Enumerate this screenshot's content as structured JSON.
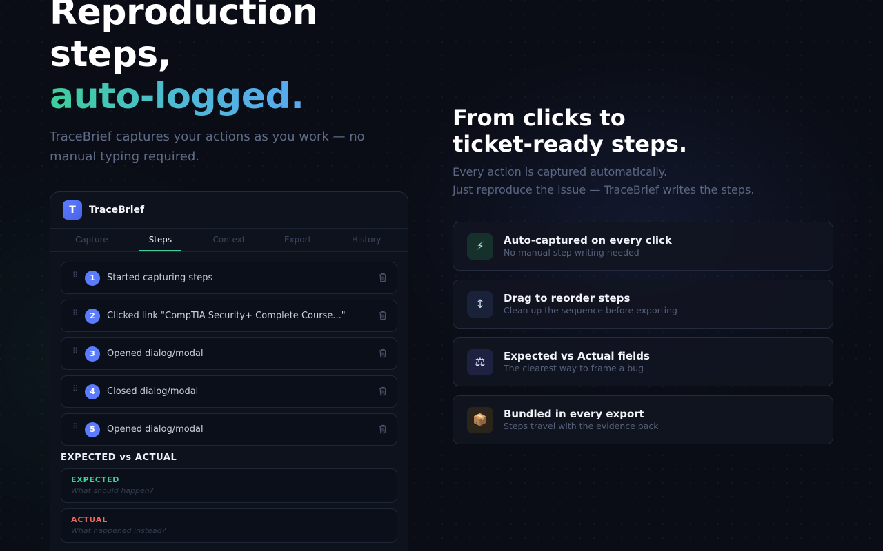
{
  "hero": {
    "title_line1": "Reproduction",
    "title_line2": "steps,",
    "title_highlight": "auto-logged.",
    "subtitle": "TraceBrief captures your actions as you work — no manual typing required."
  },
  "app": {
    "logo_letter": "T",
    "name": "TraceBrief",
    "tabs": [
      {
        "label": "Capture",
        "active": false
      },
      {
        "label": "Steps",
        "active": true
      },
      {
        "label": "Context",
        "active": false
      },
      {
        "label": "Export",
        "active": false
      },
      {
        "label": "History",
        "active": false
      }
    ],
    "steps": [
      {
        "num": "1",
        "text": "Started capturing steps"
      },
      {
        "num": "2",
        "text": "Clicked link \"CompTIA Security+ Complete Course...\""
      },
      {
        "num": "3",
        "text": "Opened dialog/modal"
      },
      {
        "num": "4",
        "text": "Closed dialog/modal"
      },
      {
        "num": "5",
        "text": "Opened dialog/modal"
      }
    ],
    "eva_title": "EXPECTED vs ACTUAL",
    "expected": {
      "label": "EXPECTED",
      "placeholder": "What should happen?",
      "value": ""
    },
    "actual": {
      "label": "ACTUAL",
      "placeholder": "What happened instead?",
      "value": ""
    }
  },
  "features": {
    "title_line1": "From clicks to",
    "title_line2": "ticket-ready steps.",
    "sub_line1": "Every action is captured automatically.",
    "sub_line2": "Just reproduce the issue — TraceBrief writes the steps.",
    "items": [
      {
        "icon": "⚡",
        "icon_name": "lightning-icon",
        "title": "Auto-captured on every click",
        "desc": "No manual step writing needed"
      },
      {
        "icon": "↕",
        "icon_name": "reorder-arrows-icon",
        "title": "Drag to reorder steps",
        "desc": "Clean up the sequence before exporting"
      },
      {
        "icon": "⚖",
        "icon_name": "scales-icon",
        "title": "Expected vs Actual fields",
        "desc": "The clearest way to frame a bug"
      },
      {
        "icon": "📦",
        "icon_name": "package-icon",
        "title": "Bundled in every export",
        "desc": "Steps travel with the evidence pack"
      }
    ]
  },
  "colors": {
    "accent_green": "#3ecf9a",
    "accent_blue": "#5b7cff",
    "actual_red": "#f06a5f",
    "background": "#0a0d15"
  }
}
